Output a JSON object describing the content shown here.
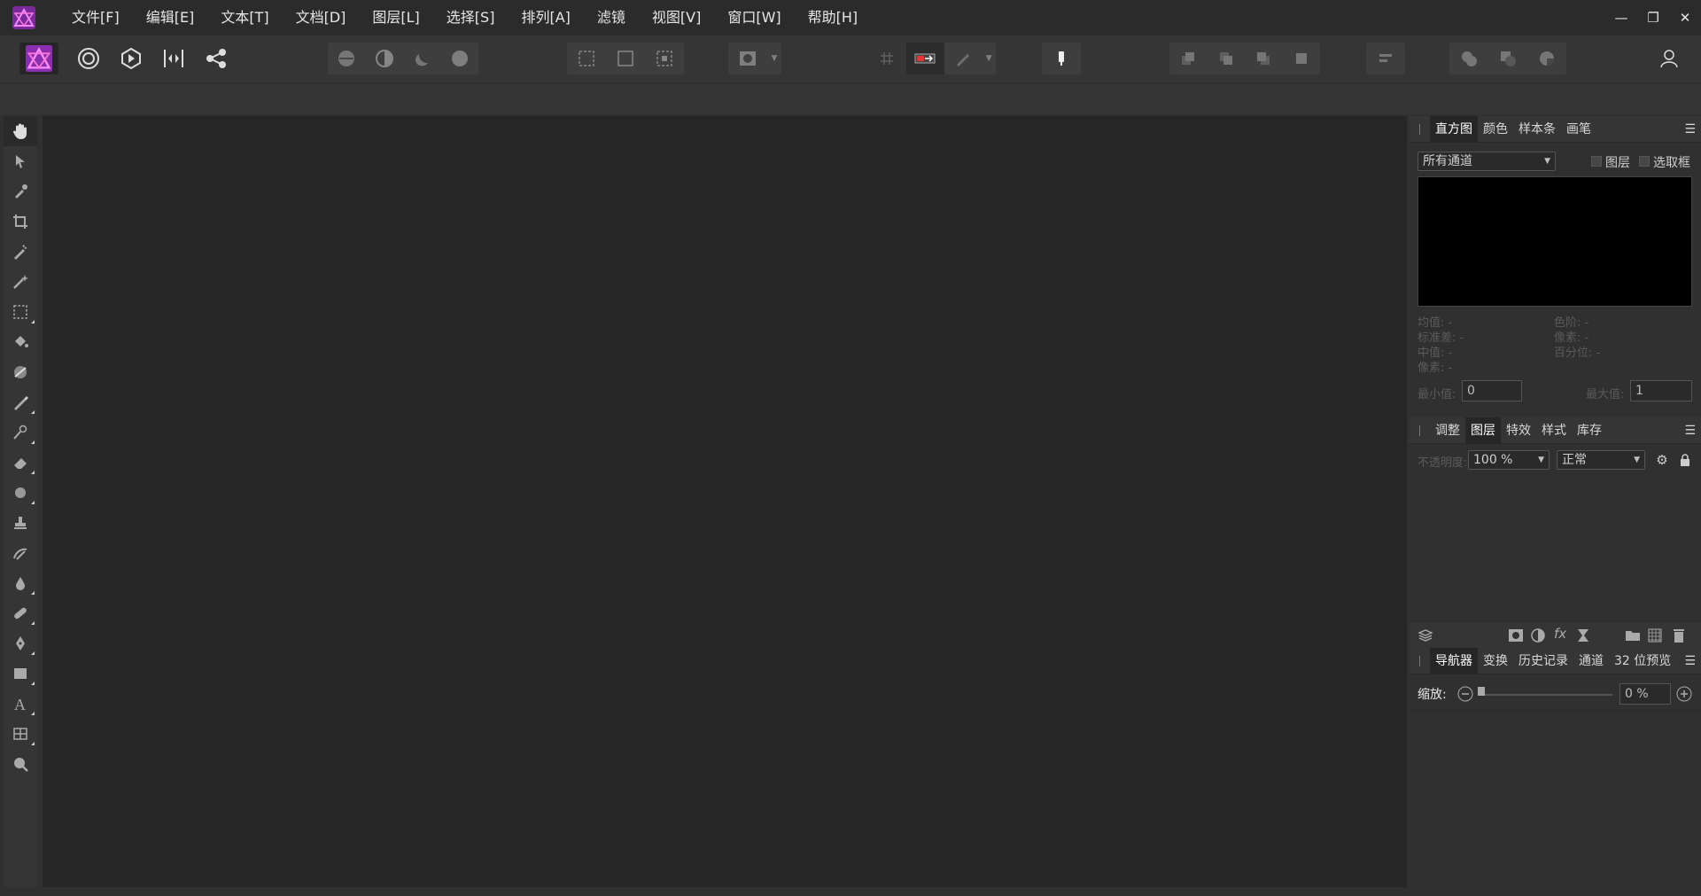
{
  "app": {
    "brand_color": "#c02ed8"
  },
  "menubar": {
    "items": [
      "文件[F]",
      "编辑[E]",
      "文本[T]",
      "文档[D]",
      "图层[L]",
      "选择[S]",
      "排列[A]",
      "滤镜",
      "视图[V]",
      "窗口[W]",
      "帮助[H]"
    ]
  },
  "window_controls": {
    "minimize": "—",
    "restore": "❐",
    "close": "✕"
  },
  "histogram_panel": {
    "tabs": [
      "直方图",
      "颜色",
      "样本条",
      "画笔"
    ],
    "active_tab": "直方图",
    "channel_select": "所有通道",
    "layer_checkbox_label": "图层",
    "marquee_checkbox_label": "选取框",
    "stats_left": [
      "均值: -",
      "标准差: -",
      "中值: -",
      "像素: -"
    ],
    "stats_right": [
      "色阶: -",
      "像素: -",
      "百分位: -"
    ],
    "min_label": "最小值:",
    "min_value": "0",
    "max_label": "最大值:",
    "max_value": "1"
  },
  "layers_panel": {
    "tabs": [
      "调整",
      "图层",
      "特效",
      "样式",
      "库存"
    ],
    "active_tab": "图层",
    "opacity_label": "不透明度:",
    "opacity_value": "100 %",
    "blend_mode": "正常"
  },
  "navigator_panel": {
    "tabs": [
      "导航器",
      "变换",
      "历史记录",
      "通道",
      "32 位预览"
    ],
    "active_tab": "导航器",
    "zoom_label": "缩放:",
    "zoom_value": "0 %"
  }
}
